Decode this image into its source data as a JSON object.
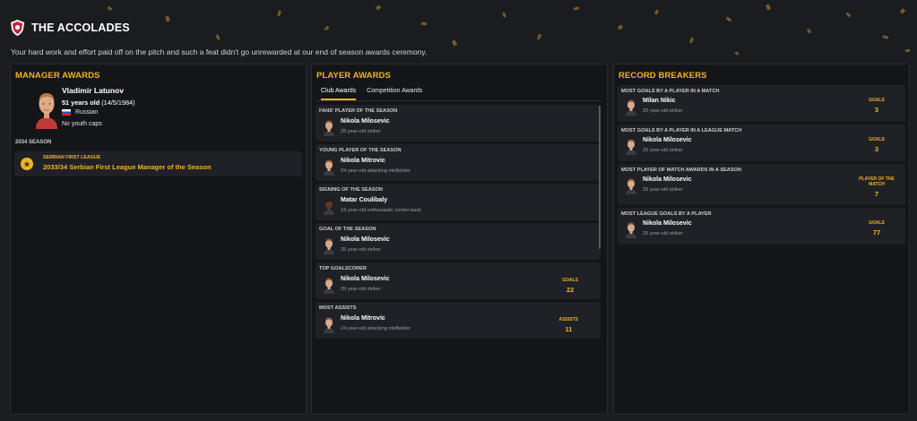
{
  "header": {
    "title": "THE ACCOLADES",
    "subtitle": "Your hard work and effort paid off on the pitch and such a feat didn't go unrewarded at our end of season awards ceremony."
  },
  "colors": {
    "accent": "#f0b323",
    "panel": "#141519",
    "card": "#202126",
    "background": "#1b1c20"
  },
  "manager_awards": {
    "title": "MANAGER AWARDS",
    "name": "Vladimir Latunov",
    "age": "51 years old",
    "dob": "(14/5/1984)",
    "nationality": "Russian",
    "caps": "No youth caps",
    "season_label": "2034 SEASON",
    "award": {
      "competition": "SERBIAN FIRST LEAGUE",
      "name": "2033/34 Serbian First League Manager of the Season",
      "icon": "medal-icon"
    }
  },
  "player_awards": {
    "title": "PLAYER AWARDS",
    "tabs": [
      "Club Awards",
      "Competition Awards"
    ],
    "active_tab": "Club Awards",
    "items": [
      {
        "category": "FANS' PLAYER OF THE SEASON",
        "player": "Nikola Milosevic",
        "desc": "25 year-old striker"
      },
      {
        "category": "YOUNG PLAYER OF THE SEASON",
        "player": "Nikola Mitrovic",
        "desc": "24 year-old attacking midfielder"
      },
      {
        "category": "SIGNING OF THE SEASON",
        "player": "Matar Coulibaly",
        "desc": "19 year-old enthusiastic centre-back"
      },
      {
        "category": "GOAL OF THE SEASON",
        "player": "Nikola Milosevic",
        "desc": "25 year-old striker"
      },
      {
        "category": "TOP GOALSCORER",
        "player": "Nikola Milosevic",
        "desc": "25 year-old striker",
        "stat_label": "GOALS",
        "stat_value": "22"
      },
      {
        "category": "MOST ASSISTS",
        "player": "Nikola Mitrovic",
        "desc": "24 year-old attacking midfielder",
        "stat_label": "ASSISTS",
        "stat_value": "11"
      }
    ]
  },
  "record_breakers": {
    "title": "RECORD BREAKERS",
    "items": [
      {
        "category": "MOST GOALS BY A PLAYER IN A MATCH",
        "player": "Milan Nikic",
        "desc": "20 year-old striker",
        "stat_label": "GOALS",
        "stat_value": "3"
      },
      {
        "category": "MOST GOALS BY A PLAYER IN A LEAGUE MATCH",
        "player": "Nikola Milosevic",
        "desc": "25 year-old striker",
        "stat_label": "GOALS",
        "stat_value": "3"
      },
      {
        "category": "MOST PLAYER OF MATCH AWARDS IN A SEASON",
        "player": "Nikola Milosevic",
        "desc": "25 year-old striker",
        "stat_label": "PLAYER OF THE MATCH",
        "stat_value": "7"
      },
      {
        "category": "MOST LEAGUE GOALS BY A PLAYER",
        "player": "Nikola Milosevic",
        "desc": "25 year-old striker",
        "stat_label": "GOALS",
        "stat_value": "77"
      }
    ]
  }
}
